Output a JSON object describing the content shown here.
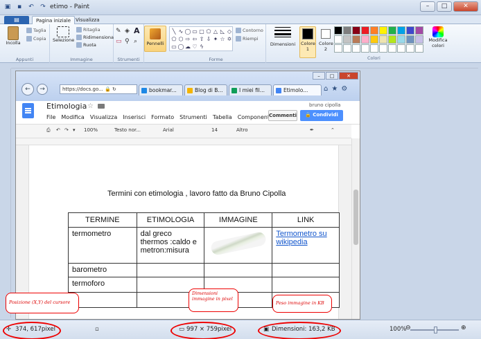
{
  "window": {
    "title": "etimo - Paint"
  },
  "ribbon": {
    "file_label": "",
    "tabs": [
      "Pagina iniziale",
      "Visualizza"
    ],
    "groups": {
      "appunti": {
        "label": "Appunti",
        "incolla": "Incolla",
        "taglia": "Taglia",
        "copia": "Copia"
      },
      "immagine": {
        "label": "Immagine",
        "selezione": "Selezione",
        "ritaglia": "Ritaglia",
        "ridimensiona": "Ridimensiona",
        "ruota": "Ruota"
      },
      "strumenti": {
        "label": "Strumenti"
      },
      "pennelli": {
        "label": "Pennelli"
      },
      "forme": {
        "label": "Forme",
        "contorno": "Contorno",
        "riempi": "Riempi"
      },
      "dimensioni": {
        "label": "Dimensioni"
      },
      "colori": {
        "label": "Colori",
        "colore1": "Colore 1",
        "colore2": "Colore 2",
        "modifica": "Modifica colori"
      }
    },
    "palette": [
      "#000000",
      "#7f7f7f",
      "#880015",
      "#ed1c24",
      "#ff7f27",
      "#fff200",
      "#22b14c",
      "#00a2e8",
      "#3f48cc",
      "#a349a4",
      "#ffffff",
      "#c3c3c3",
      "#b97a57",
      "#ffaec9",
      "#ffc90e",
      "#efe4b0",
      "#b5e61d",
      "#99d9ea",
      "#7092be",
      "#c8bfe7",
      "#ffffff",
      "#ffffff",
      "#ffffff",
      "#ffffff",
      "#ffffff",
      "#ffffff",
      "#ffffff",
      "#ffffff",
      "#ffffff",
      "#ffffff"
    ]
  },
  "browser": {
    "url": "https://docs.go...",
    "tabs": [
      {
        "label": "Etimolo...",
        "color": "#4285f4",
        "active": true
      },
      {
        "label": "I miei fil...",
        "color": "#0f9d58",
        "active": false
      },
      {
        "label": "Blog di B...",
        "color": "#f4b400",
        "active": false
      },
      {
        "label": "bookmar...",
        "color": "#1e88e5",
        "active": false
      }
    ]
  },
  "docs": {
    "title": "Etimologia",
    "menu": [
      "File",
      "Modifica",
      "Visualizza",
      "Inserisci",
      "Formato",
      "Strumenti",
      "Tabella",
      "Componenti"
    ],
    "user": "bruno cipolla",
    "comments_button": "Commenti",
    "share_button": "Condividi",
    "toolbar": {
      "zoom": "100%",
      "style": "Testo nor...",
      "font": "Arial",
      "size": "14",
      "more": "Altro"
    },
    "heading": "Termini con etimologia , lavoro fatto da Bruno Cipolla",
    "table": {
      "headers": [
        "TERMINE",
        "ETIMOLOGIA",
        "IMMAGINE",
        "LINK"
      ],
      "rows": [
        [
          "termometro",
          "dal greco thermos :caldo e metron:misura",
          "",
          "Termometro su wikipedia"
        ],
        [
          "barometro",
          "",
          "",
          ""
        ],
        [
          "termoforo",
          "",
          "",
          ""
        ]
      ]
    }
  },
  "annotations": {
    "cursor": "Posizione (X,Y) del cursore",
    "dims": "Dimensioni immagine in pixel",
    "weight": "Peso immagine in KB"
  },
  "status": {
    "cursor_pos": "374, 617pixel",
    "image_size": "997 × 759pixel",
    "file_size": "Dimensioni: 163,2 KB",
    "zoom": "100%"
  }
}
